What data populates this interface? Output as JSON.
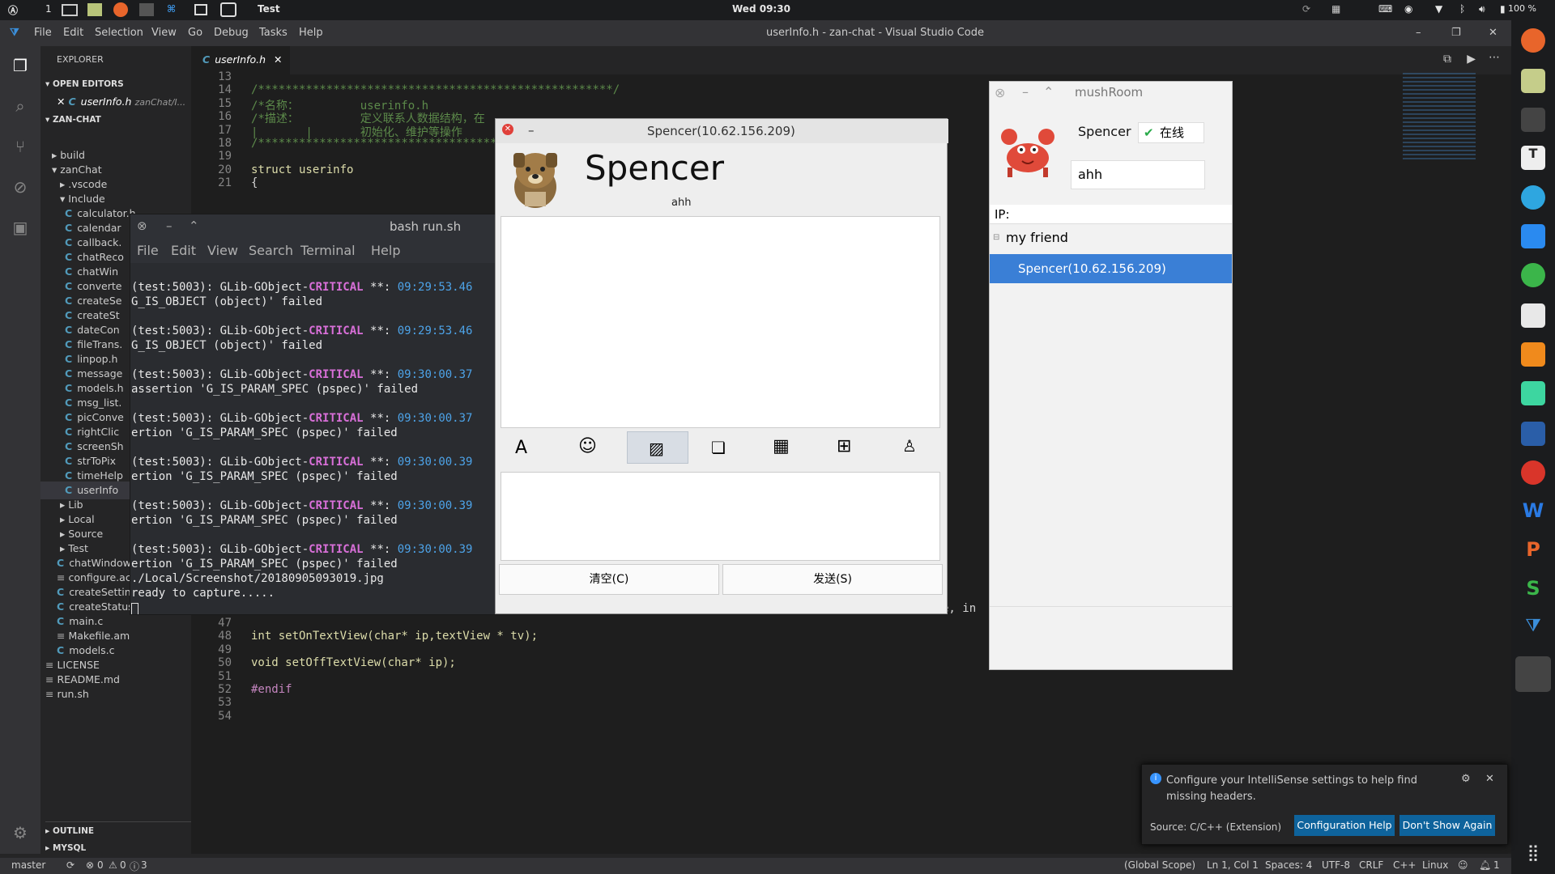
{
  "topbar": {
    "workspace": "1",
    "active_app": "Test",
    "clock": "Wed 09:30",
    "battery": "100 %"
  },
  "vscode": {
    "title": "userInfo.h - zan-chat - Visual Studio Code",
    "menu": [
      "File",
      "Edit",
      "Selection",
      "View",
      "Go",
      "Debug",
      "Tasks",
      "Help"
    ],
    "explorer": {
      "header": "EXPLORER",
      "open_editors": "OPEN EDITORS",
      "open_file": "userInfo.h",
      "open_file_path": "zanChat/I...",
      "root": "ZAN-CHAT",
      "tree": [
        "build",
        "zanChat",
        ".vscode",
        "Include",
        "calculator.h",
        "calendar",
        "callback.",
        "chatReco",
        "chatWin",
        "converte",
        "createSe",
        "createSt",
        "dateCon",
        "fileTrans.",
        "linpop.h",
        "message",
        "models.h",
        "msg_list.",
        "picConve",
        "rightClic",
        "screenSh",
        "strToPix",
        "timeHelp",
        "userInfo",
        "Lib",
        "Local",
        "Source",
        "Test",
        "chatWindow.c",
        "configure.ac",
        "createSettings.c",
        "createStatusMenu.c",
        "main.c",
        "Makefile.am",
        "models.c",
        "LICENSE",
        "README.md",
        "run.sh"
      ],
      "outline": "OUTLINE",
      "mysql": "MYSQL"
    },
    "tab": "userInfo.h",
    "code_top": [
      {
        "n": "13",
        "t": ""
      },
      {
        "n": "14",
        "t": "/****************************************************/"
      },
      {
        "n": "15",
        "t": "/*名称：         userinfo.h"
      },
      {
        "n": "16",
        "t": "/*描述：         定义联系人数据结构，在"
      },
      {
        "n": "17",
        "t": "|       |       初始化、维护等操作"
      },
      {
        "n": "18",
        "t": "/****************************************"
      },
      {
        "n": "19",
        "t": ""
      },
      {
        "n": "20",
        "t": "struct userinfo"
      },
      {
        "n": "21",
        "t": "{"
      }
    ],
    "code_bottom": [
      {
        "n": "47",
        "t": ""
      },
      {
        "n": "48",
        "t": "int setOnTextView(char* ip,textView * tv);"
      },
      {
        "n": "49",
        "t": ""
      },
      {
        "n": "50",
        "t": "void setOffTextView(char* ip);"
      },
      {
        "n": "51",
        "t": ""
      },
      {
        "n": "52",
        "t": "#endif"
      },
      {
        "n": "53",
        "t": ""
      },
      {
        "n": "54",
        "t": ""
      }
    ],
    "code_fragment": "e, in",
    "status": {
      "branch": "master",
      "errors": "0",
      "warnings": "0",
      "info": "3",
      "scope": "(Global Scope)",
      "position": "Ln 1, Col 1",
      "spaces": "Spaces: 4",
      "encoding": "UTF-8",
      "eol": "CRLF",
      "language": "C++",
      "platform": "Linux",
      "bell": "1"
    }
  },
  "terminal": {
    "title": "bash run.sh",
    "menu": [
      "File",
      "Edit",
      "View",
      "Search",
      "Terminal",
      "Help"
    ],
    "lines": [
      {
        "pre": "(test:5003): GLib-GObject-",
        "crit": "CRITICAL",
        "mid": " **: ",
        "time": "09:29:53.46",
        "next": "G_IS_OBJECT (object)' failed"
      },
      {
        "pre": "(test:5003): GLib-GObject-",
        "crit": "CRITICAL",
        "mid": " **: ",
        "time": "09:29:53.46",
        "next": "G_IS_OBJECT (object)' failed"
      },
      {
        "pre": "(test:5003): GLib-GObject-",
        "crit": "CRITICAL",
        "mid": " **: ",
        "time": "09:30:00.37",
        "next": "assertion 'G_IS_PARAM_SPEC (pspec)' failed"
      },
      {
        "pre": "(test:5003): GLib-GObject-",
        "crit": "CRITICAL",
        "mid": " **: ",
        "time": "09:30:00.37",
        "next": "ertion 'G_IS_PARAM_SPEC (pspec)' failed"
      },
      {
        "pre": "(test:5003): GLib-GObject-",
        "crit": "CRITICAL",
        "mid": " **: ",
        "time": "09:30:00.39",
        "next": "ertion 'G_IS_PARAM_SPEC (pspec)' failed"
      },
      {
        "pre": "(test:5003): GLib-GObject-",
        "crit": "CRITICAL",
        "mid": " **: ",
        "time": "09:30:00.39",
        "next": "ertion 'G_IS_PARAM_SPEC (pspec)' failed"
      },
      {
        "pre": "(test:5003): GLib-GObject-",
        "crit": "CRITICAL",
        "mid": " **: ",
        "time": "09:30:00.39",
        "next": "ertion 'G_IS_PARAM_SPEC (pspec)' failed"
      }
    ],
    "screenshot_line": "./Local/Screenshot/20180905093019.jpg",
    "ready_line": "ready to capture....."
  },
  "chat": {
    "title": "Spencer(10.62.156.209)",
    "name": "Spencer",
    "signature": "ahh",
    "clear_button": "清空(C)",
    "send_button": "发送(S)"
  },
  "mushroom": {
    "title": "mushRoom",
    "user": "Spencer",
    "status": "在线",
    "signature": "ahh",
    "ip_label": "IP:",
    "group": "my friend",
    "friend": "Spencer(10.62.156.209)"
  },
  "notification": {
    "message": "Configure your IntelliSense settings to help find missing headers.",
    "source": "Source: C/C++ (Extension)",
    "btn_primary": "Configuration Help",
    "btn_secondary": "Don't Show Again"
  }
}
